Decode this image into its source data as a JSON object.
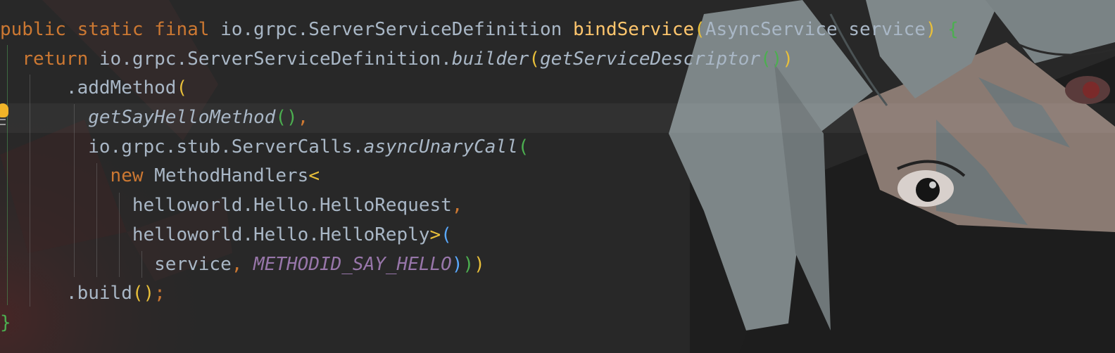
{
  "editor": {
    "lines": [
      {
        "indent": "",
        "tokens": [
          {
            "t": "public static final ",
            "c": "kw"
          },
          {
            "t": "io.grpc.ServerServiceDefinition ",
            "c": ""
          },
          {
            "t": "bindService",
            "c": "fn"
          },
          {
            "t": "(",
            "c": "p1"
          },
          {
            "t": "AsyncService service",
            "c": ""
          },
          {
            "t": ") ",
            "c": "p1"
          },
          {
            "t": "{",
            "c": "p2"
          }
        ]
      },
      {
        "indent": "  ",
        "tokens": [
          {
            "t": "return ",
            "c": "kw"
          },
          {
            "t": "io.grpc.ServerServiceDefinition.",
            "c": ""
          },
          {
            "t": "builder",
            "c": "it"
          },
          {
            "t": "(",
            "c": "p1"
          },
          {
            "t": "getServiceDescriptor",
            "c": "it"
          },
          {
            "t": "()",
            "c": "p2"
          },
          {
            "t": ")",
            "c": "p1"
          }
        ]
      },
      {
        "indent": "      ",
        "tokens": [
          {
            "t": ".addMethod",
            "c": ""
          },
          {
            "t": "(",
            "c": "p1"
          }
        ]
      },
      {
        "indent": "        ",
        "tokens": [
          {
            "t": "getSayHelloMethod",
            "c": "it"
          },
          {
            "t": "()",
            "c": "p2"
          },
          {
            "t": ",",
            "c": "kw"
          }
        ]
      },
      {
        "indent": "        ",
        "tokens": [
          {
            "t": "io.grpc.stub.ServerCalls.",
            "c": ""
          },
          {
            "t": "asyncUnaryCall",
            "c": "it"
          },
          {
            "t": "(",
            "c": "p2"
          }
        ]
      },
      {
        "indent": "          ",
        "tokens": [
          {
            "t": "new ",
            "c": "kw"
          },
          {
            "t": "MethodHandlers",
            "c": ""
          },
          {
            "t": "<",
            "c": "p1"
          }
        ]
      },
      {
        "indent": "            ",
        "tokens": [
          {
            "t": "helloworld.Hello.HelloRequest",
            "c": ""
          },
          {
            "t": ",",
            "c": "kw"
          }
        ]
      },
      {
        "indent": "            ",
        "tokens": [
          {
            "t": "helloworld.Hello.HelloReply",
            "c": ""
          },
          {
            "t": ">",
            "c": "p1"
          },
          {
            "t": "(",
            "c": "p3"
          }
        ]
      },
      {
        "indent": "              ",
        "tokens": [
          {
            "t": "service",
            "c": ""
          },
          {
            "t": ", ",
            "c": "kw"
          },
          {
            "t": "METHODID_SAY_HELLO",
            "c": "const"
          },
          {
            "t": ")",
            "c": "p3"
          },
          {
            "t": ")",
            "c": "p2"
          },
          {
            "t": ")",
            "c": "p1"
          }
        ]
      },
      {
        "indent": "      ",
        "tokens": [
          {
            "t": ".build",
            "c": ""
          },
          {
            "t": "()",
            "c": "p1"
          },
          {
            "t": ";",
            "c": "kw"
          }
        ]
      },
      {
        "indent": "",
        "tokens": [
          {
            "t": "}",
            "c": "p2"
          }
        ]
      }
    ]
  },
  "gutter": {
    "intention_icon": "lightbulb-icon"
  },
  "theme": {
    "background": "#2b2b2b",
    "keyword": "#cc7832",
    "method_decl": "#ffc66d",
    "constant": "#9876aa",
    "text": "#a9b7c6"
  }
}
